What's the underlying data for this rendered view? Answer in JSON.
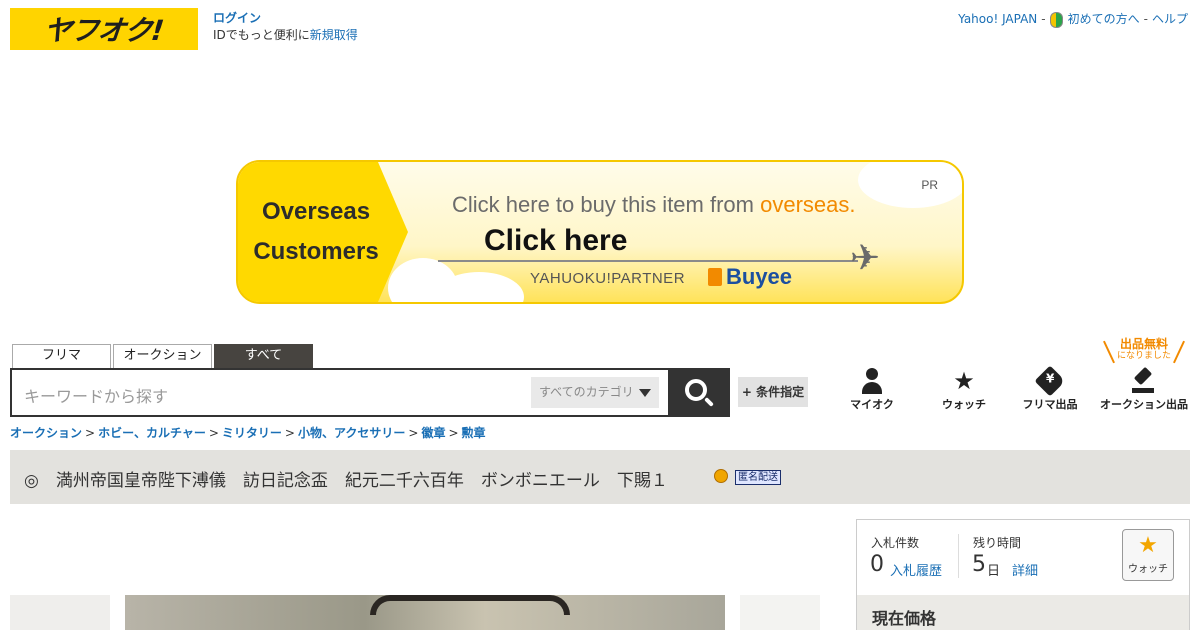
{
  "header": {
    "logo_text": "ヤフオク!",
    "login_label": "ログイン",
    "signup_prefix": "IDでもっと便利に",
    "signup_link": "新規取得",
    "links": [
      "Yahoo! JAPAN",
      "初めての方へ",
      "ヘルプ"
    ],
    "link_separator": "-"
  },
  "banner": {
    "left_line1": "Overseas",
    "left_line2": "Customers",
    "buy_text": "Click here to buy this item from ",
    "buy_highlight": "overseas.",
    "click_text": "Click here",
    "partner_text": "YAHUOKU!PARTNER",
    "buyee_text": "Buyee",
    "pr_label": "PR"
  },
  "search": {
    "tabs": [
      {
        "label": "フリマ",
        "active": false
      },
      {
        "label": "オークション",
        "active": false
      },
      {
        "label": "すべて",
        "active": true
      }
    ],
    "placeholder": "キーワードから探す",
    "category_label": "すべてのカテゴリ",
    "condition_button": "+ 条件指定"
  },
  "free_badge": {
    "line1": "出品無料",
    "line2": "になりました"
  },
  "nav_icons": [
    {
      "label": "マイオク",
      "icon": "person-icon"
    },
    {
      "label": "ウォッチ",
      "icon": "star-icon"
    },
    {
      "label": "フリマ出品",
      "icon": "price-tag-icon"
    },
    {
      "label": "オークション出品",
      "icon": "gavel-icon"
    }
  ],
  "breadcrumb": [
    "オークション",
    "ホビー、カルチャー",
    "ミリタリー",
    "小物、アクセサリー",
    "徽章",
    "勲章"
  ],
  "breadcrumb_separator": ">",
  "item": {
    "title": "◎　満州帝国皇帝陛下溥儀　訪日記念盃　紀元二千六百年　ボンボニエール　下賜１",
    "anonymous_badge": "匿名配送"
  },
  "bid_box": {
    "bid_count_label": "入札件数",
    "bid_count": "0",
    "bid_history_link": "入札履歴",
    "time_left_label": "残り時間",
    "time_left_value": "5",
    "time_left_unit": "日",
    "detail_link": "詳細",
    "watch_label": "ウォッチ",
    "current_price_label": "現在価格"
  },
  "colors": {
    "brand_yellow": "#ffd400",
    "link_blue": "#1a6fb5",
    "accent_orange": "#f28a00",
    "tab_active_bg": "#474440",
    "title_bar_bg": "#e3e2de"
  }
}
